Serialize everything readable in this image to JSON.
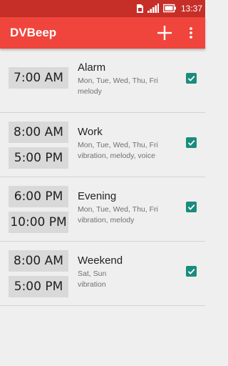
{
  "status_bar": {
    "time": "13:37",
    "icons": [
      "sim-icon",
      "signal-icon",
      "battery-icon"
    ]
  },
  "app_bar": {
    "title": "DVBeep",
    "add_icon": "plus-icon",
    "menu_icon": "more-vert-icon"
  },
  "colors": {
    "status_bar": "#c62f28",
    "app_bar": "#f0453c",
    "checkbox": "#1a8c7d",
    "background": "#efefef"
  },
  "alarms": [
    {
      "times": [
        "7:00 AM"
      ],
      "title": "Alarm",
      "days": "Mon, Tue, Wed, Thu, Fri",
      "sound": "melody",
      "enabled": true
    },
    {
      "times": [
        "8:00 AM",
        "5:00 PM"
      ],
      "title": "Work",
      "days": "Mon, Tue, Wed, Thu, Fri",
      "sound": "vibration, melody, voice",
      "enabled": true
    },
    {
      "times": [
        "6:00 PM",
        "10:00 PM"
      ],
      "title": "Evening",
      "days": "Mon, Tue, Wed, Thu, Fri",
      "sound": "vibration, melody",
      "enabled": true
    },
    {
      "times": [
        "8:00 AM",
        "5:00 PM"
      ],
      "title": "Weekend",
      "days": "Sat, Sun",
      "sound": "vibration",
      "enabled": true
    }
  ]
}
